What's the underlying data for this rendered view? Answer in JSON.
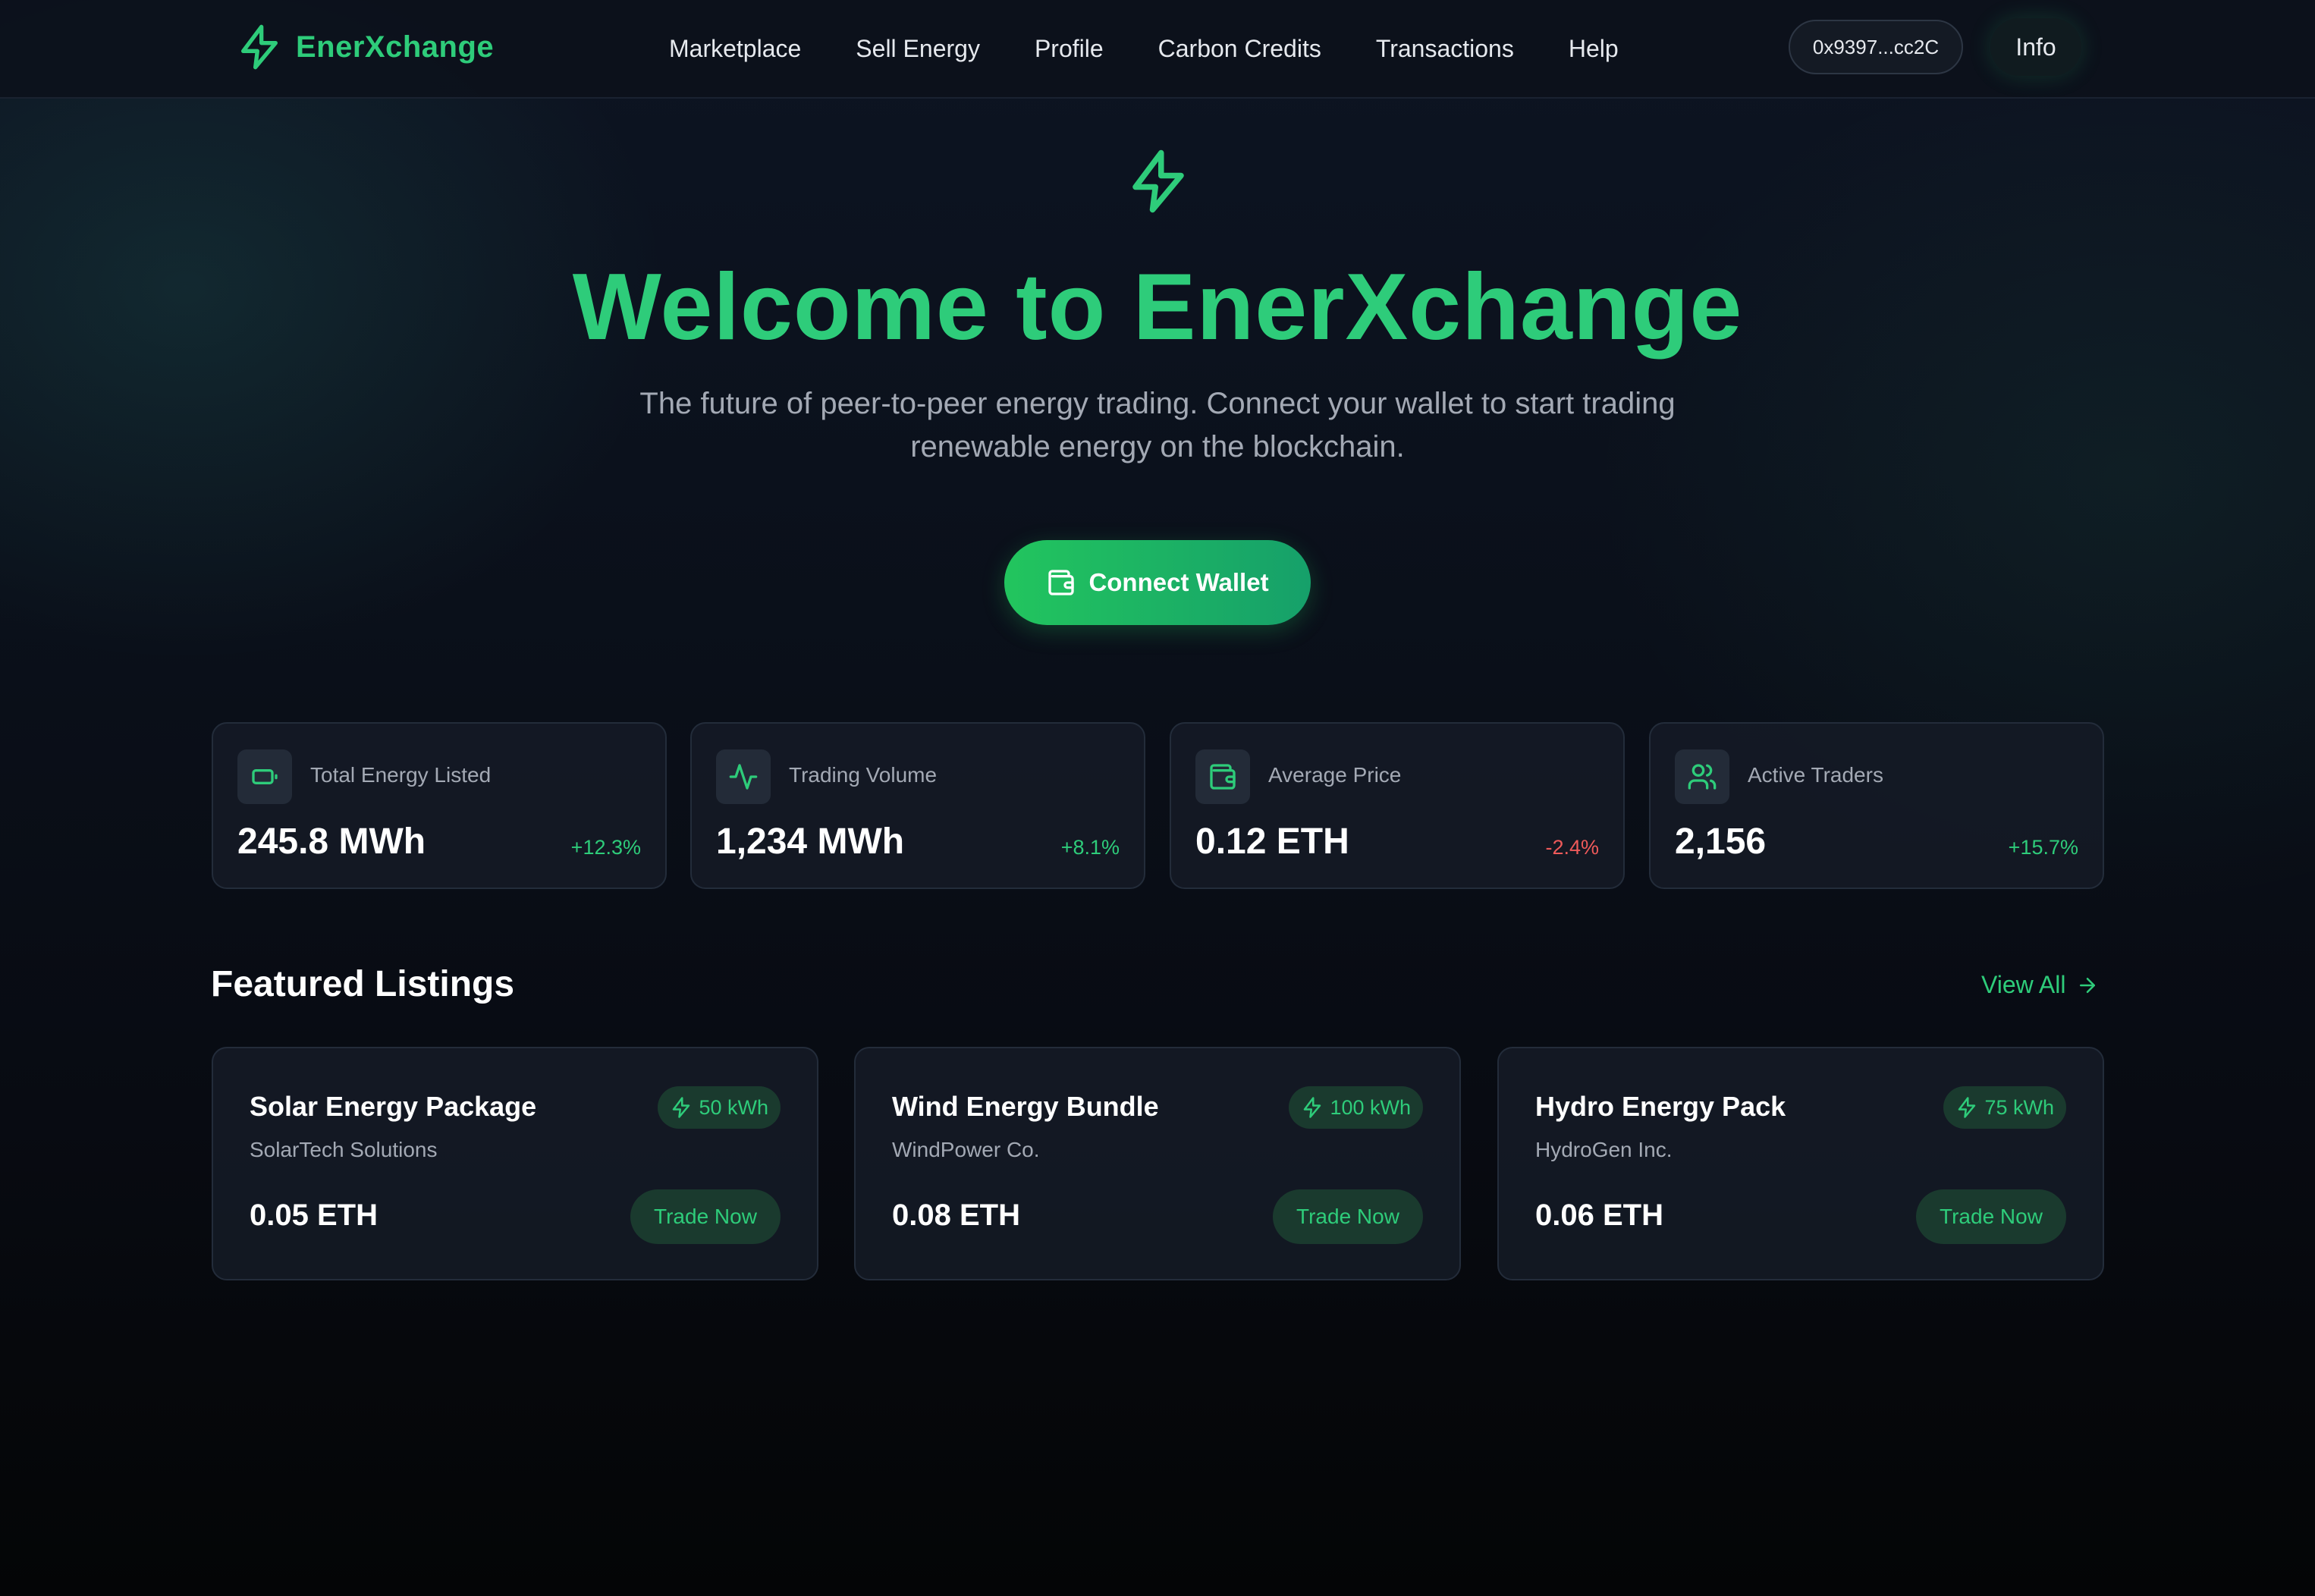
{
  "brand": {
    "name": "EnerXchange",
    "icon": "lightning-bolt-icon"
  },
  "nav": {
    "links": [
      "Marketplace",
      "Sell Energy",
      "Profile",
      "Carbon Credits",
      "Transactions",
      "Help"
    ],
    "wallet_address": "0x9397...cc2C",
    "info_label": "Info"
  },
  "hero": {
    "title": "Welcome to EnerXchange",
    "subtitle": "The future of peer-to-peer energy trading. Connect your wallet to start trading renewable energy on the blockchain.",
    "connect_label": "Connect Wallet"
  },
  "stats": [
    {
      "label": "Total Energy Listed",
      "value": "245.8 MWh",
      "change": "+12.3%",
      "trend": "up",
      "icon": "battery-icon"
    },
    {
      "label": "Trading Volume",
      "value": "1,234 MWh",
      "change": "+8.1%",
      "trend": "up",
      "icon": "activity-icon"
    },
    {
      "label": "Average Price",
      "value": "0.12 ETH",
      "change": "-2.4%",
      "trend": "down",
      "icon": "wallet-icon"
    },
    {
      "label": "Active Traders",
      "value": "2,156",
      "change": "+15.7%",
      "trend": "up",
      "icon": "users-icon"
    }
  ],
  "featured": {
    "title": "Featured Listings",
    "view_all": "View All",
    "listings": [
      {
        "title": "Solar Energy Package",
        "seller": "SolarTech Solutions",
        "amount": "50 kWh",
        "price": "0.05 ETH",
        "action": "Trade Now"
      },
      {
        "title": "Wind Energy Bundle",
        "seller": "WindPower Co.",
        "amount": "100 kWh",
        "price": "0.08 ETH",
        "action": "Trade Now"
      },
      {
        "title": "Hydro Energy Pack",
        "seller": "HydroGen Inc.",
        "amount": "75 kWh",
        "price": "0.06 ETH",
        "action": "Trade Now"
      }
    ]
  },
  "colors": {
    "accent": "#2ecc7a",
    "negative": "#ef5a5a",
    "background": "#0b111c"
  }
}
